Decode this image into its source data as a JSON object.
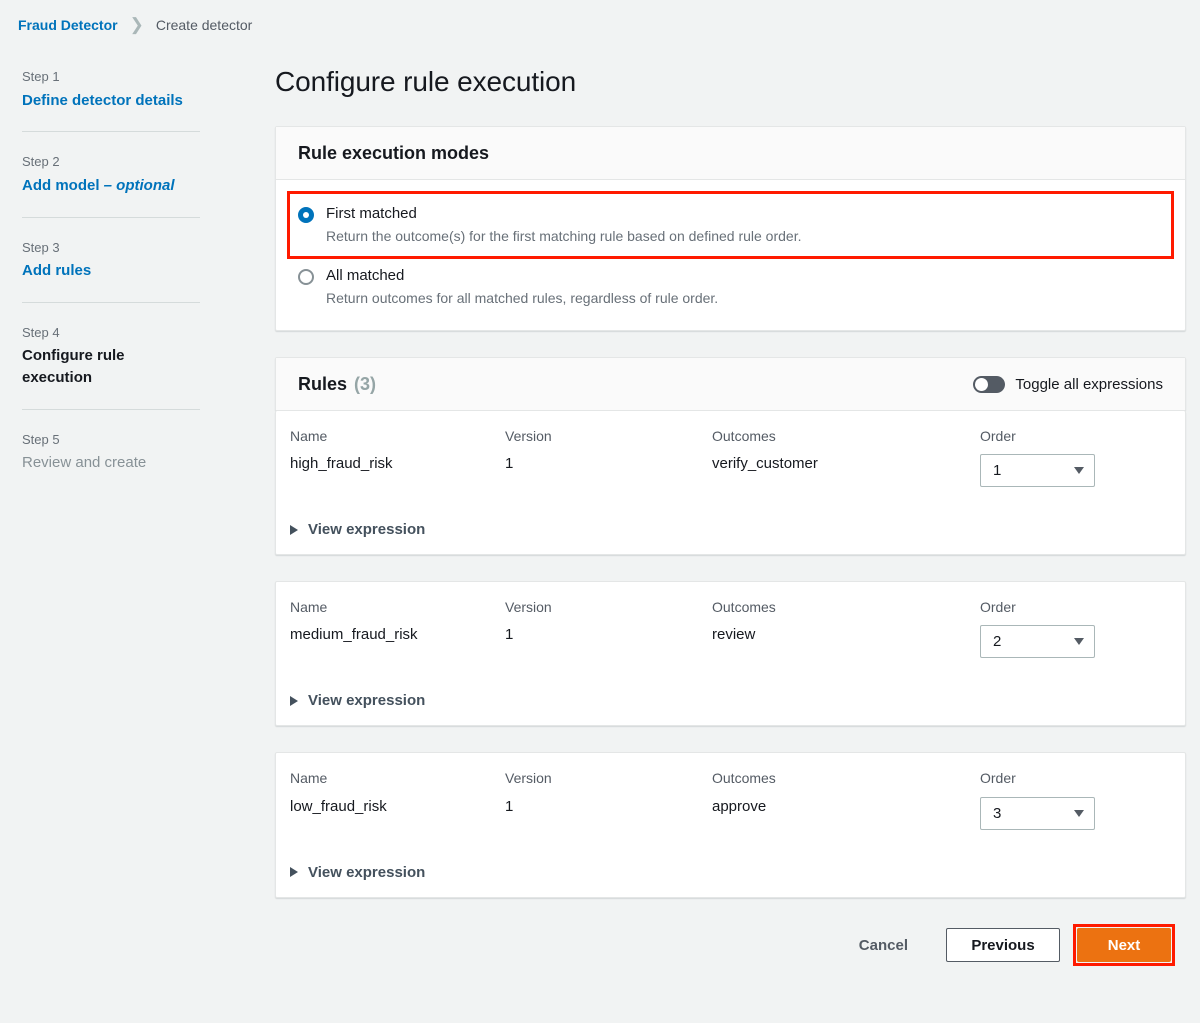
{
  "breadcrumb": {
    "root": "Fraud Detector",
    "separator_icon": "chevron-right-icon",
    "current": "Create detector"
  },
  "sidebar": {
    "steps": [
      {
        "num": "Step 1",
        "title": "Define detector details",
        "state": "link"
      },
      {
        "num": "Step 2",
        "title": "Add model ",
        "optional": "– optional",
        "state": "link"
      },
      {
        "num": "Step 3",
        "title": "Add rules",
        "state": "link"
      },
      {
        "num": "Step 4",
        "title": "Configure rule execution",
        "state": "active"
      },
      {
        "num": "Step 5",
        "title": "Review and create",
        "state": "muted"
      }
    ]
  },
  "main": {
    "page_title": "Configure rule execution",
    "modes_card": {
      "title": "Rule execution modes",
      "options": [
        {
          "label": "First matched",
          "description": "Return the outcome(s) for the first matching rule based on defined rule order.",
          "selected": true,
          "highlighted": true
        },
        {
          "label": "All matched",
          "description": "Return outcomes for all matched rules, regardless of rule order.",
          "selected": false,
          "highlighted": false
        }
      ]
    },
    "rules_card": {
      "title": "Rules",
      "count": "(3)",
      "toggle": {
        "label": "Toggle all expressions",
        "state": "off",
        "icon": "toggle-switch-icon"
      },
      "columns": {
        "name": "Name",
        "version": "Version",
        "outcomes": "Outcomes",
        "order": "Order"
      },
      "expression_link": "View expression",
      "expression_icon": "triangle-right-icon",
      "rules": [
        {
          "name": "high_fraud_risk",
          "version": "1",
          "outcomes": "verify_customer",
          "order": "1"
        },
        {
          "name": "medium_fraud_risk",
          "version": "1",
          "outcomes": "review",
          "order": "2"
        },
        {
          "name": "low_fraud_risk",
          "version": "1",
          "outcomes": "approve",
          "order": "3"
        }
      ]
    },
    "footer": {
      "cancel": "Cancel",
      "previous": "Previous",
      "next": "Next",
      "next_highlighted": true
    }
  },
  "colors": {
    "page_background": "#f1f3f3",
    "link": "#0073bb",
    "primary_button": "#ec7211",
    "highlight_outline": "#ff1a00",
    "radio_selected": "#0073bb",
    "toggle_off_track": "#545b64"
  }
}
